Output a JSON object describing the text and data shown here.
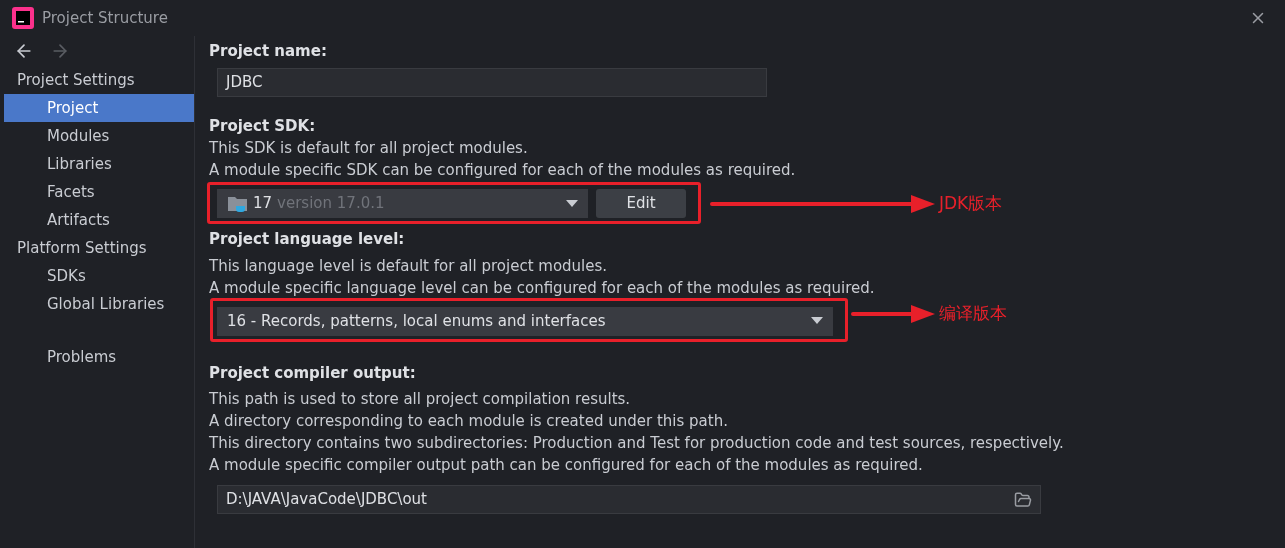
{
  "window": {
    "title": "Project Structure"
  },
  "sidebar": {
    "groups": [
      {
        "heading": "Project Settings",
        "items": [
          {
            "label": "Project",
            "selected": true
          },
          {
            "label": "Modules",
            "selected": false
          },
          {
            "label": "Libraries",
            "selected": false
          },
          {
            "label": "Facets",
            "selected": false
          },
          {
            "label": "Artifacts",
            "selected": false
          }
        ]
      },
      {
        "heading": "Platform Settings",
        "items": [
          {
            "label": "SDKs",
            "selected": false
          },
          {
            "label": "Global Libraries",
            "selected": false
          }
        ]
      },
      {
        "items": [
          {
            "label": "Problems",
            "selected": false
          }
        ]
      }
    ]
  },
  "project_name": {
    "label": "Project name:",
    "value": "JDBC"
  },
  "project_sdk": {
    "label": "Project SDK:",
    "description": [
      "This SDK is default for all project modules.",
      "A module specific SDK can be configured for each of the modules as required."
    ],
    "sdk_name": "17",
    "sdk_version": "version 17.0.1",
    "edit_button": "Edit"
  },
  "language_level": {
    "label": "Project language level:",
    "description": [
      "This language level is default for all project modules.",
      "A module specific language level can be configured for each of the modules as required."
    ],
    "value": "16 - Records, patterns, local enums and interfaces"
  },
  "compiler_output": {
    "label": "Project compiler output:",
    "description": [
      "This path is used to store all project compilation results.",
      "A directory corresponding to each module is created under this path.",
      "This directory contains two subdirectories: Production and Test for production code and test sources, respectively.",
      "A module specific compiler output path can be configured for each of the modules as required."
    ],
    "value": "D:\\JAVA\\JavaCode\\JDBC\\out"
  },
  "annotations": [
    {
      "label": "JDK版本"
    },
    {
      "label": "编译版本"
    }
  ]
}
